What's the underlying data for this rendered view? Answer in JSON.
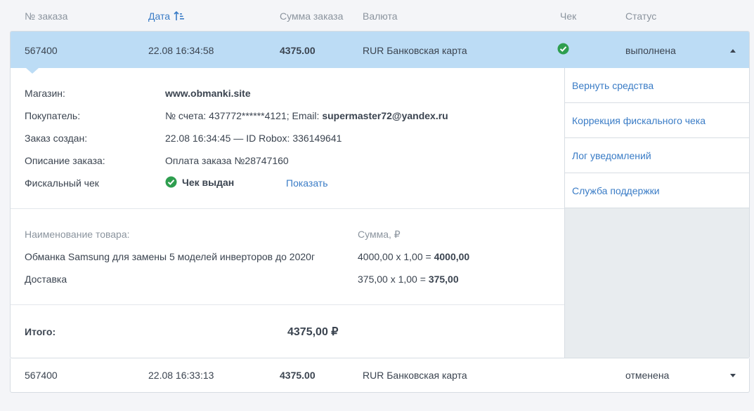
{
  "header": {
    "order_no": "№ заказа",
    "date": "Дата",
    "sum": "Сумма заказа",
    "currency": "Валюта",
    "check": "Чек",
    "status": "Статус"
  },
  "orders": [
    {
      "number": "567400",
      "date": "22.08 16:34:58",
      "sum": "4375.00",
      "currency": "RUR Банковская карта",
      "status": "выполнена"
    },
    {
      "number": "567400",
      "date": "22.08 16:33:13",
      "sum": "4375.00",
      "currency": "RUR Банковская карта",
      "status": "отменена"
    }
  ],
  "details": {
    "shop_label": "Магазин:",
    "shop_value": "www.obmanki.site",
    "buyer_label": "Покупатель:",
    "buyer_account": "№ счета: 437772******4121; Email: ",
    "buyer_email": "supermaster72@yandex.ru",
    "created_label": "Заказ создан:",
    "created_value": "22.08 16:34:45 — ID Robox: 336149641",
    "desc_label": "Описание заказа:",
    "desc_value": "Оплата заказа №28747160",
    "fiscal_label": "Фискальный чек",
    "fiscal_value": "Чек выдан",
    "fiscal_link": "Показать"
  },
  "goods": {
    "name_header": "Наименование товара:",
    "sum_header": "Сумма, ₽",
    "items": [
      {
        "name": "Обманка Samsung для замены 5 моделей инверторов до 2020г",
        "calc": "4000,00 x 1,00 = ",
        "total": "4000,00"
      },
      {
        "name": "Доставка",
        "calc": "375,00 x 1,00 = ",
        "total": "375,00"
      }
    ],
    "total_label": "Итого:",
    "total_value": "4375,00 ₽"
  },
  "actions": [
    "Вернуть средства",
    "Коррекция фискального чека",
    "Лог уведомлений",
    "Служба поддержки"
  ],
  "colors": {
    "accent": "#3a7cc6",
    "selected_row": "#bcdcf5",
    "success": "#2e9e4f"
  }
}
